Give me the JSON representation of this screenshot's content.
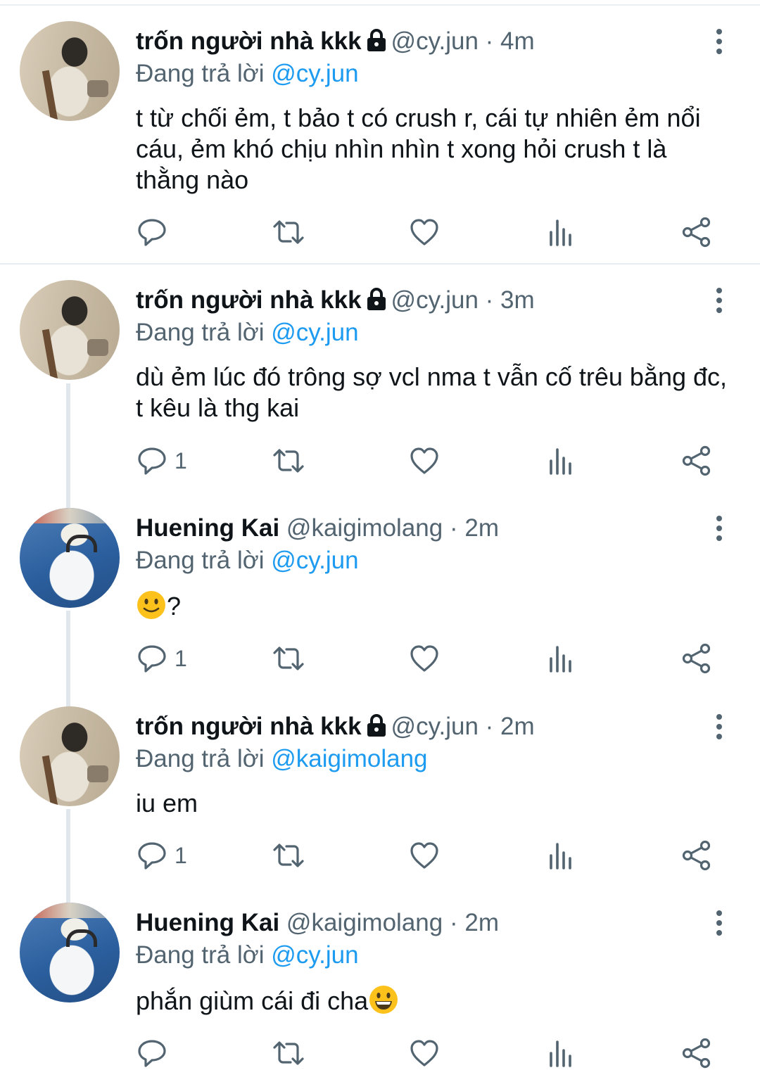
{
  "tweets": [
    {
      "name": "trốn người nhà kkk",
      "handle": "@cy.jun",
      "time": "· 4m",
      "replying_prefix": "Đang trả lời ",
      "replying_to": "@cy.jun",
      "text": "t từ chối ẻm, t bảo t có crush r, cái tự nhiên ẻm nổi cáu, ẻm khó chịu nhìn nhìn t xong hỏi crush t là thằng nào",
      "reply_count": ""
    },
    {
      "name": "trốn người nhà kkk",
      "handle": "@cy.jun",
      "time": "· 3m",
      "replying_prefix": "Đang trả lời ",
      "replying_to": "@cy.jun",
      "text": "dù ẻm lúc đó trông sợ vcl nma t vẫn cố trêu bằng đc, t kêu là thg kai",
      "reply_count": "1"
    },
    {
      "name": "Huening Kai",
      "handle": "@kaigimolang",
      "time": "· 2m",
      "replying_prefix": "Đang trả lời ",
      "replying_to": "@cy.jun",
      "text": "?",
      "reply_count": "1"
    },
    {
      "name": "trốn người nhà kkk",
      "handle": "@cy.jun",
      "time": "· 2m",
      "replying_prefix": "Đang trả lời ",
      "replying_to": "@kaigimolang",
      "text": "iu em",
      "reply_count": "1"
    },
    {
      "name": "Huening Kai",
      "handle": "@kaigimolang",
      "time": "· 2m",
      "replying_prefix": "Đang trả lời ",
      "replying_to": "@cy.jun",
      "text": "phắn giùm cái đi cha",
      "reply_count": ""
    }
  ],
  "icons": {
    "reply": "reply-icon",
    "retweet": "retweet-icon",
    "like": "heart-icon",
    "views": "analytics-icon",
    "share": "share-icon",
    "more": "more-vertical-icon",
    "lock": "lock-icon"
  },
  "colors": {
    "text": "#0f1419",
    "muted": "#536471",
    "mention": "#1d9bf0",
    "divider": "#e6ecf0"
  }
}
